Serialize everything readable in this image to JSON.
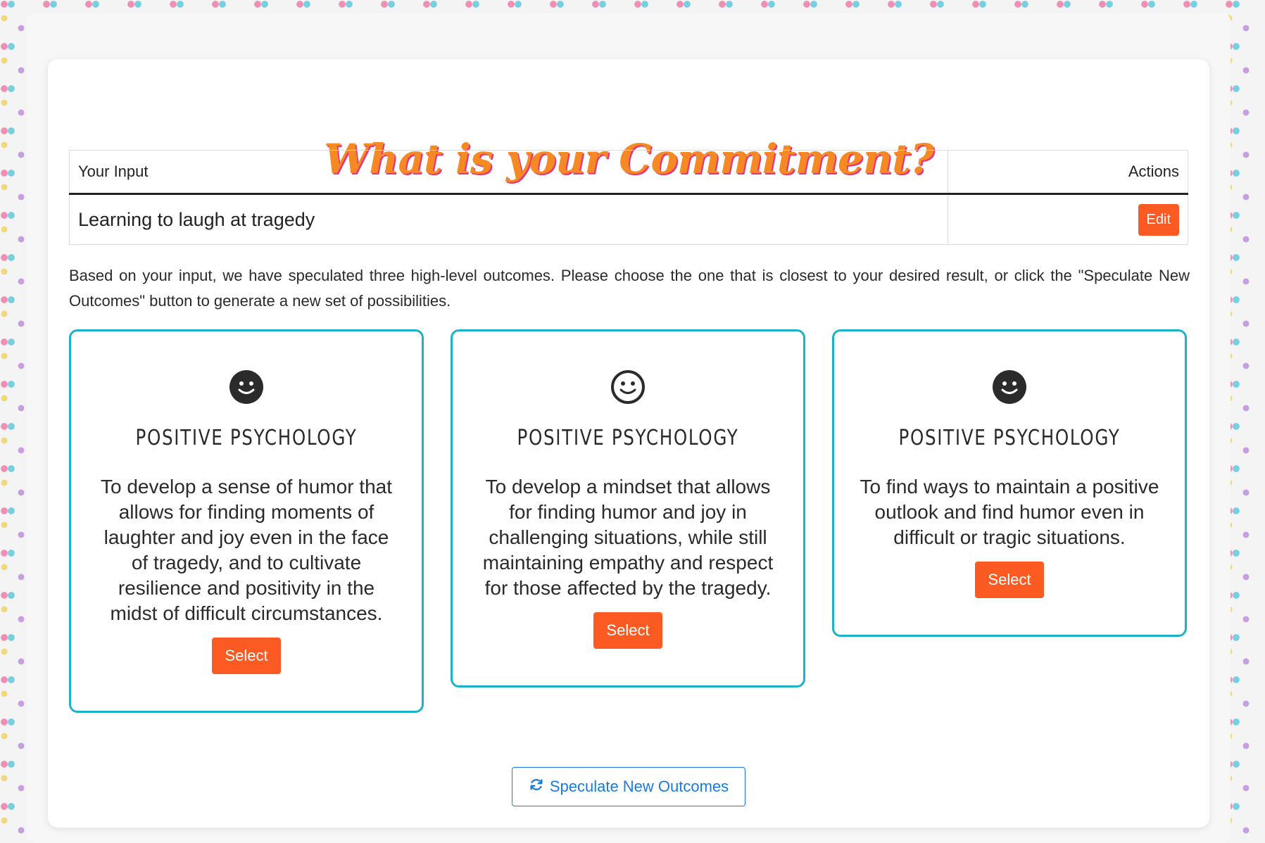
{
  "page": {
    "title": "What is your Commitment?"
  },
  "input_table": {
    "headers": [
      "Your Input",
      "Actions"
    ],
    "row": {
      "value": "Learning to laugh at tragedy",
      "edit_label": "Edit"
    }
  },
  "intro": "Based on your input, we have speculated three high-level outcomes. Please choose the one that is closest to your desired result, or click the \"Speculate New Outcomes\" button to generate a new set of possibilities.",
  "outcomes": [
    {
      "icon": "smiley-filled-icon",
      "category": "POSITIVE PSYCHOLOGY",
      "description": "To develop a sense of humor that allows for finding moments of laughter and joy even in the face of tragedy, and to cultivate resilience and positivity in the midst of difficult circumstances.",
      "select_label": "Select"
    },
    {
      "icon": "smiley-outline-icon",
      "category": "POSITIVE PSYCHOLOGY",
      "description": "To develop a mindset that allows for finding humor and joy in challenging situations, while still maintaining empathy and respect for those affected by the tragedy.",
      "select_label": "Select"
    },
    {
      "icon": "smiley-filled-icon",
      "category": "POSITIVE PSYCHOLOGY",
      "description": "To find ways to maintain a positive outlook and find humor even in difficult or tragic situations.",
      "select_label": "Select"
    }
  ],
  "speculate_button": {
    "icon": "refresh-icon",
    "label": "Speculate New Outcomes"
  },
  "colors": {
    "accent": "#fb5a22",
    "card_border": "#1ab3c9",
    "link_blue": "#1a7bde",
    "title_orange": "#f58a24",
    "title_shadow_pink": "#e8357a"
  }
}
